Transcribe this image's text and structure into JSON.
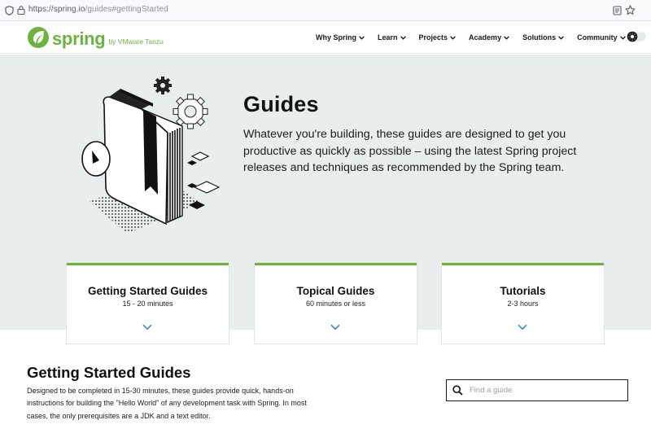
{
  "browser": {
    "url_host": "https://spring.io",
    "url_path": "/guides#gettingStarted",
    "icons": [
      "shield-icon",
      "lock-icon",
      "reader-view-icon",
      "bookmark-star-icon"
    ]
  },
  "header": {
    "logo_word": "spring",
    "logo_tag": "by VMware Tanzu",
    "brand_color": "#6db33f",
    "nav": [
      {
        "label": "Why Spring"
      },
      {
        "label": "Learn"
      },
      {
        "label": "Projects"
      },
      {
        "label": "Academy"
      },
      {
        "label": "Solutions"
      },
      {
        "label": "Community"
      }
    ]
  },
  "hero": {
    "title": "Guides",
    "description": "Whatever you're building, these guides are designed to get you productive as quickly as possible – using the latest Spring project releases and techniques as recommended by the Spring team.",
    "background": "#e8eeed"
  },
  "cards": [
    {
      "title": "Getting Started Guides",
      "subtitle": "15 - 20 minutes"
    },
    {
      "title": "Topical Guides",
      "subtitle": "60 minutes or less"
    },
    {
      "title": "Tutorials",
      "subtitle": "2-3 hours"
    }
  ],
  "section": {
    "title": "Getting Started Guides",
    "description": "Designed to be completed in 15-30 minutes, these guides provide quick, hands-on instructions for building the \"Hello World\" of any development task with Spring. In most cases, the only prerequisites are a JDK and a text editor."
  },
  "search": {
    "placeholder": "Find a guide"
  }
}
